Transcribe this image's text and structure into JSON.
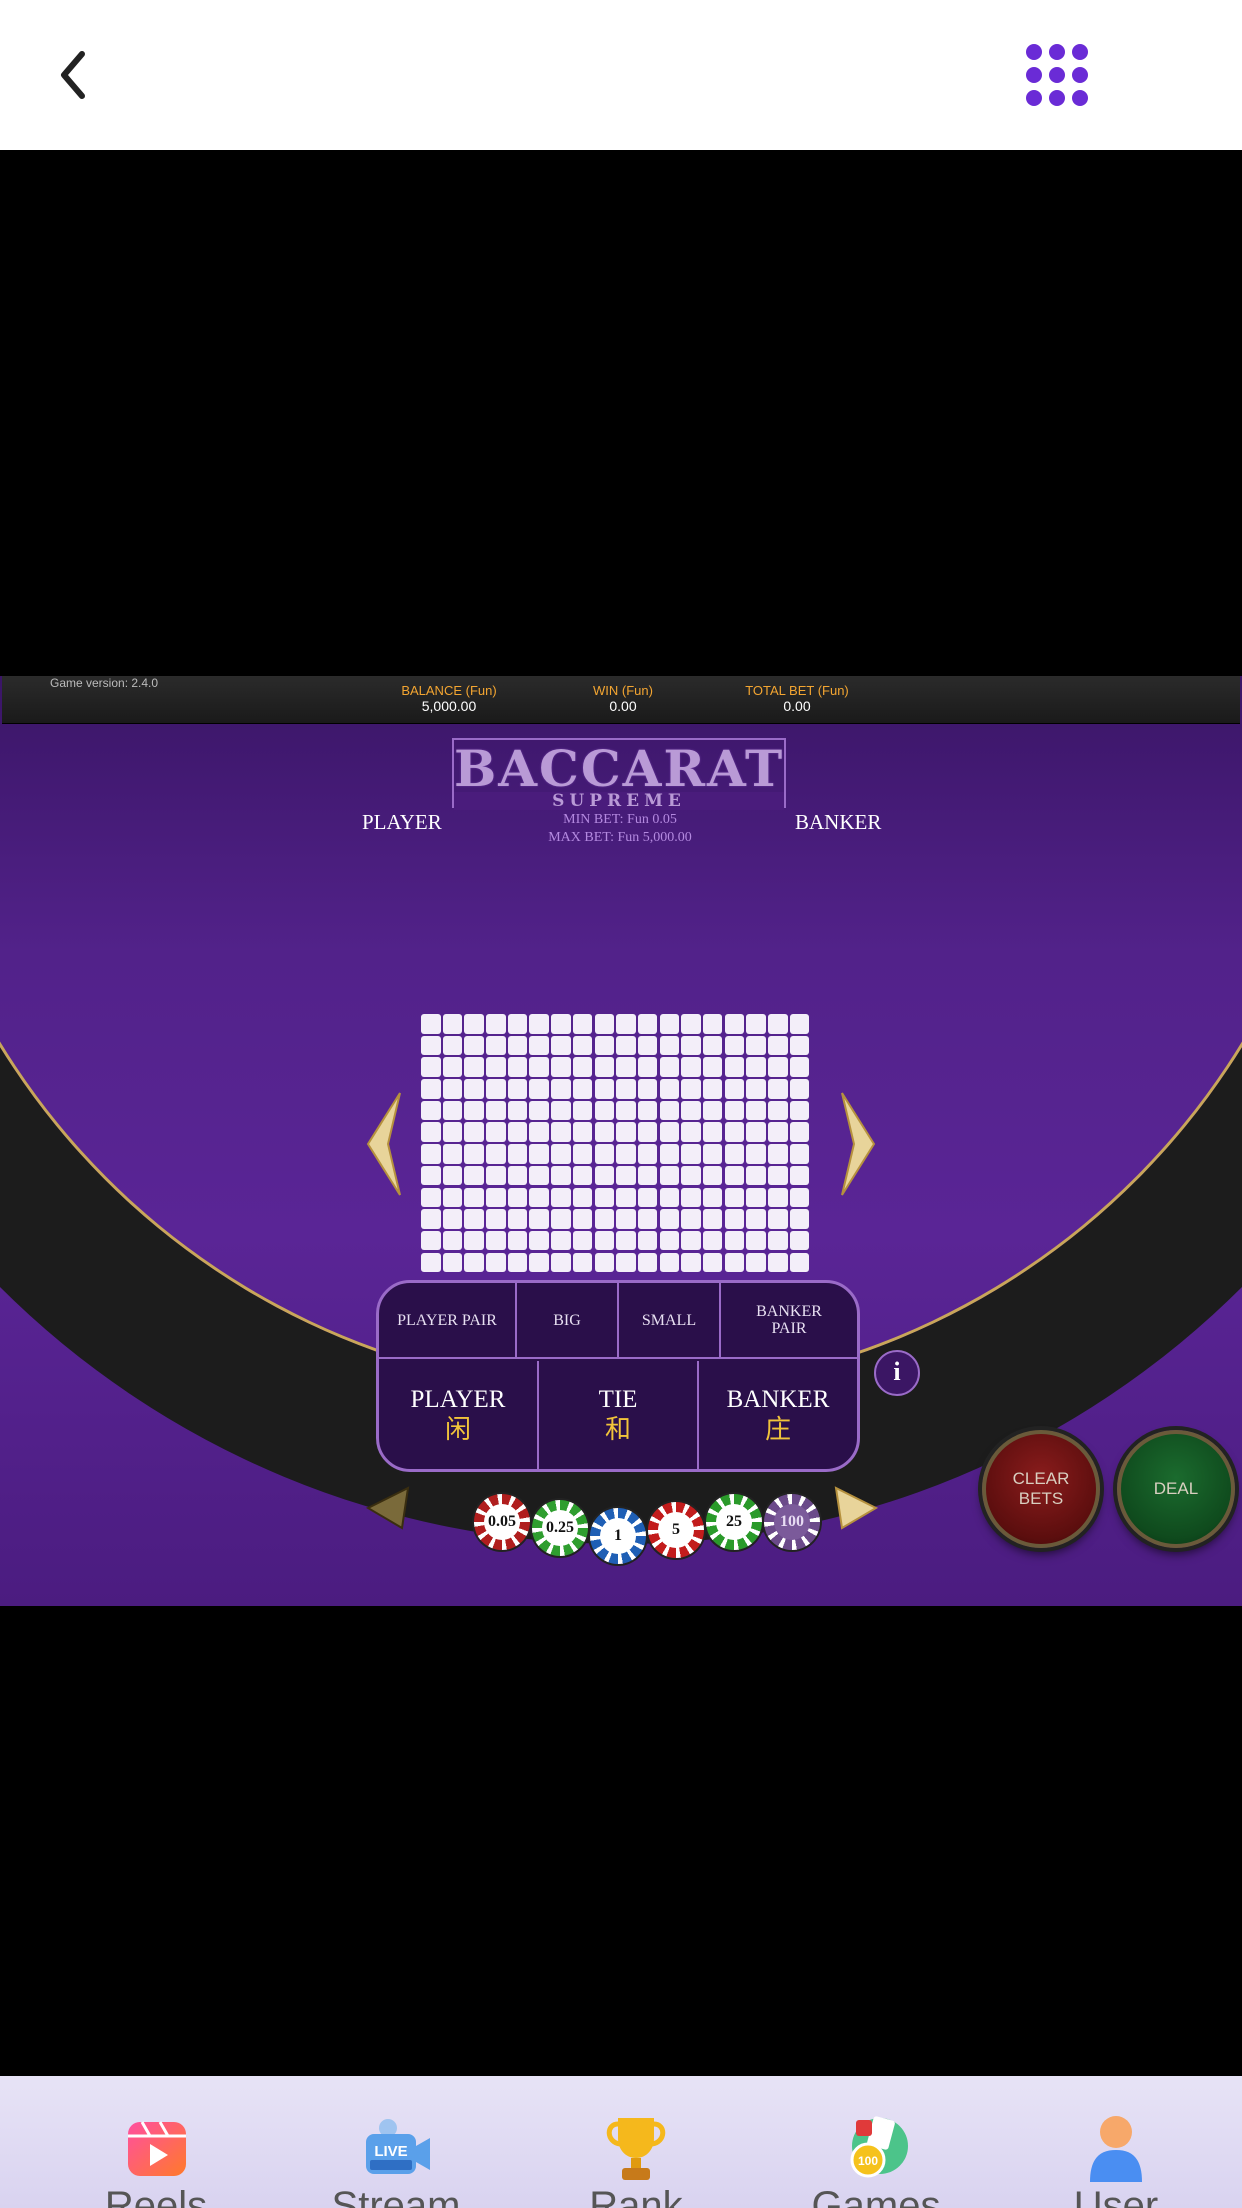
{
  "header": {
    "back_icon": "chevron-left-icon",
    "menu_icon": "dots-grid-icon",
    "menu_color": "#6a2bd6"
  },
  "game": {
    "version": "Game version: 2.4.0",
    "stats": [
      {
        "label": "BALANCE (Fun)",
        "value": "5,000.00"
      },
      {
        "label": "WIN (Fun)",
        "value": "0.00"
      },
      {
        "label": "TOTAL BET (Fun)",
        "value": "0.00"
      }
    ],
    "logo_title": "BACCARAT",
    "logo_subtitle": "SUPREME",
    "player_label": "PLAYER",
    "banker_label": "BANKER",
    "min_bet": "MIN BET: Fun 0.05",
    "max_bet": "MAX BET: Fun 5,000.00",
    "side_bets": [
      "PLAYER PAIR",
      "BIG",
      "SMALL",
      "BANKER PAIR"
    ],
    "main_bets": [
      {
        "en": "PLAYER",
        "cn": "闲"
      },
      {
        "en": "TIE",
        "cn": "和"
      },
      {
        "en": "BANKER",
        "cn": "庄"
      }
    ],
    "info": "i",
    "clear_bets": "CLEAR BETS",
    "deal": "DEAL",
    "chips": [
      {
        "value": "0.05",
        "color": "#b01e1e"
      },
      {
        "value": "0.25",
        "color": "#2f9e2f"
      },
      {
        "value": "1",
        "color": "#1f5fb5"
      },
      {
        "value": "5",
        "color": "#c21c1c"
      },
      {
        "value": "25",
        "color": "#2a9a2a"
      },
      {
        "value": "100",
        "color": "#6b4a8a"
      }
    ]
  },
  "bottom_nav": [
    {
      "label": "Reels",
      "icon": "reels-icon"
    },
    {
      "label": "Stream",
      "icon": "live-stream-icon"
    },
    {
      "label": "Rank",
      "icon": "trophy-icon"
    },
    {
      "label": "Games",
      "icon": "casino-chips-icon"
    },
    {
      "label": "User",
      "icon": "user-icon"
    }
  ]
}
